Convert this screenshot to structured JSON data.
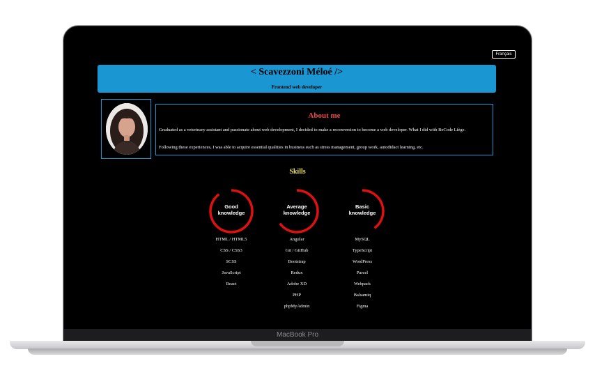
{
  "device_label": "MacBook Pro",
  "lang_button": "Français",
  "header": {
    "title": "< Scavezzoni Méloé />",
    "subtitle": "Frontend web developer"
  },
  "about": {
    "title": "About me",
    "p1": "Graduated as a veterinary assistant and passionate about web development, I decided to make a reconversion to become a web developer. What I did with BeCode Liège.",
    "p2": "Following these experiences, I was able to acquire essential qualities in business such as stress management, group work, autodidact learning, etc."
  },
  "skills": {
    "title": "Skills",
    "ring_color": "#e01010",
    "groups": [
      {
        "label_line1": "Good",
        "label_line2": "knowledge",
        "level": 0.9,
        "items": [
          "HTML / HTML5",
          "CSS / CSS3",
          "SCSS",
          "JavaScript",
          "React"
        ]
      },
      {
        "label_line1": "Average",
        "label_line2": "knowledge",
        "level": 0.65,
        "items": [
          "Angular",
          "Git / GitHub",
          "Bootstrap",
          "Redux",
          "Adobe XD",
          "PHP",
          "phpMyAdmin"
        ]
      },
      {
        "label_line1": "Basic",
        "label_line2": "knowledge",
        "level": 0.4,
        "items": [
          "MySQL",
          "TypeScript",
          "WordPress",
          "Parcel",
          "Webpack",
          "Balsamiq",
          "Figma"
        ]
      }
    ]
  },
  "colors": {
    "accent": "#1a96d2",
    "about_title": "#f04848",
    "skills_title": "#e8e060"
  }
}
